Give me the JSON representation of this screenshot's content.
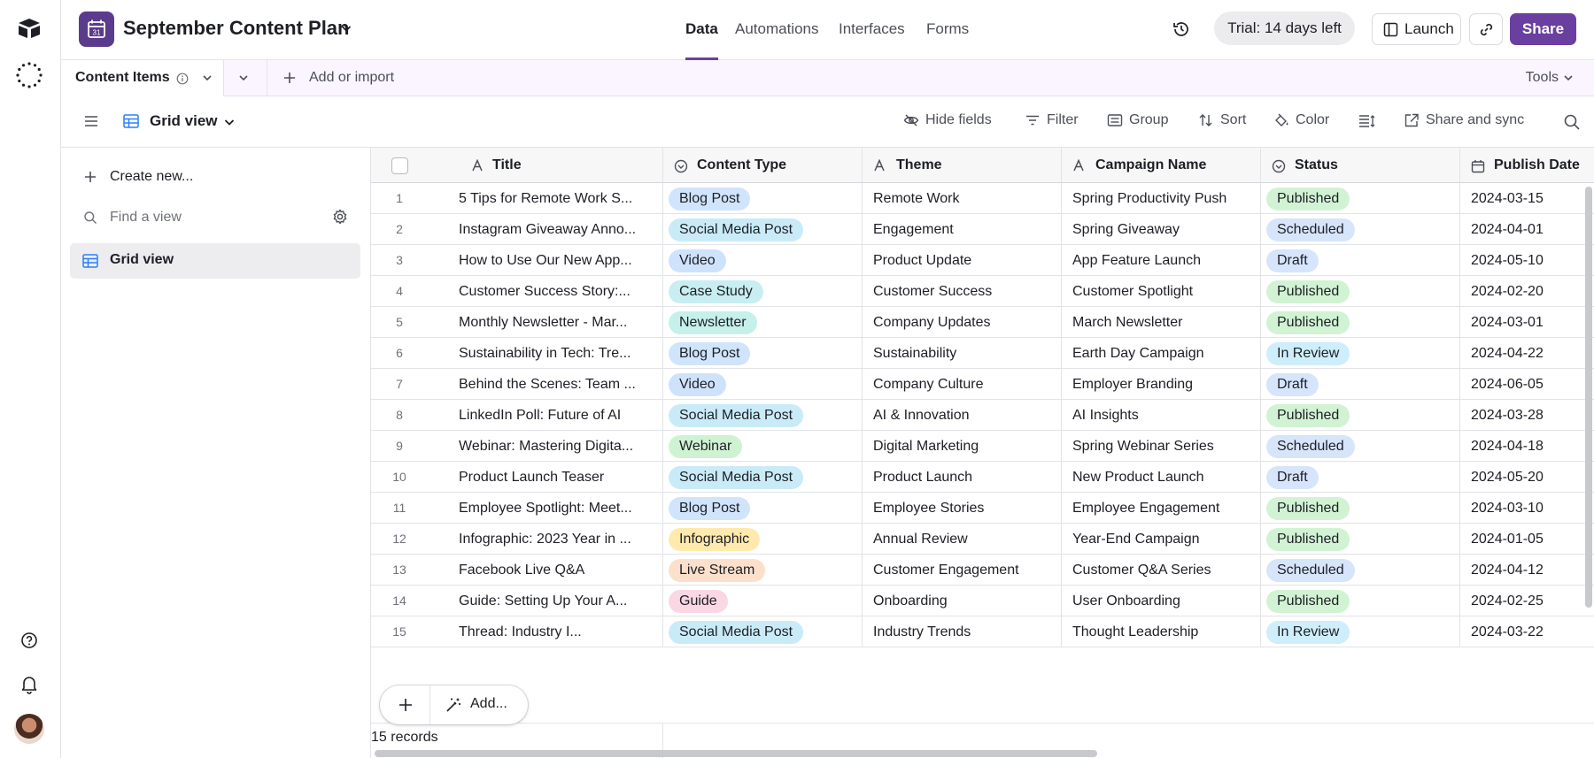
{
  "base": {
    "title": "September Content Plan",
    "icon": "calendar-icon",
    "calendar_day": "31",
    "brand_color": "#5b3b8c"
  },
  "nav": {
    "tabs": [
      {
        "label": "Data",
        "active": true
      },
      {
        "label": "Automations"
      },
      {
        "label": "Interfaces"
      },
      {
        "label": "Forms"
      }
    ]
  },
  "header": {
    "trial": "Trial: 14 days left",
    "launch": "Launch",
    "share": "Share",
    "accent": "#6a3fa0"
  },
  "tabs": {
    "table": "Content Items",
    "add_import": "Add or import",
    "tools": "Tools"
  },
  "view": {
    "name": "Grid view"
  },
  "toolbar": {
    "hide_fields": "Hide fields",
    "filter": "Filter",
    "group": "Group",
    "sort": "Sort",
    "color": "Color",
    "share_sync": "Share and sync"
  },
  "sidebar": {
    "create_new": "Create new...",
    "find_placeholder": "Find a view",
    "views": [
      {
        "label": "Grid view"
      }
    ]
  },
  "columns": {
    "title": "Title",
    "content_type": "Content Type",
    "theme": "Theme",
    "campaign": "Campaign Name",
    "status": "Status",
    "publish_date": "Publish Date"
  },
  "pill_colors": {
    "Blog Post": "#d0e4fb",
    "Social Media Post": "#c9ebf8",
    "Video": "#cfe2fc",
    "Case Study": "#c8eef2",
    "Newsletter": "#c6f0ea",
    "Webinar": "#cff2d3",
    "Infographic": "#ffe9ad",
    "Live Stream": "#fde0cc",
    "Guide": "#fbd6e3",
    "Published": "#d1f3d3",
    "Scheduled": "#d7e5fb",
    "Draft": "#d6e5fb",
    "In Review": "#cdeefa"
  },
  "rows": [
    {
      "n": "1",
      "title": "5 Tips for Remote Work S...",
      "type": "Blog Post",
      "theme": "Remote Work",
      "campaign": "Spring Productivity Push",
      "status": "Published",
      "date": "2024-03-15"
    },
    {
      "n": "2",
      "title": "Instagram Giveaway Anno...",
      "type": "Social Media Post",
      "theme": "Engagement",
      "campaign": "Spring Giveaway",
      "status": "Scheduled",
      "date": "2024-04-01"
    },
    {
      "n": "3",
      "title": "How to Use Our New App...",
      "type": "Video",
      "theme": "Product Update",
      "campaign": "App Feature Launch",
      "status": "Draft",
      "date": "2024-05-10"
    },
    {
      "n": "4",
      "title": "Customer Success Story:...",
      "type": "Case Study",
      "theme": "Customer Success",
      "campaign": "Customer Spotlight",
      "status": "Published",
      "date": "2024-02-20"
    },
    {
      "n": "5",
      "title": "Monthly Newsletter - Mar...",
      "type": "Newsletter",
      "theme": "Company Updates",
      "campaign": "March Newsletter",
      "status": "Published",
      "date": "2024-03-01"
    },
    {
      "n": "6",
      "title": "Sustainability in Tech: Tre...",
      "type": "Blog Post",
      "theme": "Sustainability",
      "campaign": "Earth Day Campaign",
      "status": "In Review",
      "date": "2024-04-22"
    },
    {
      "n": "7",
      "title": "Behind the Scenes: Team ...",
      "type": "Video",
      "theme": "Company Culture",
      "campaign": "Employer Branding",
      "status": "Draft",
      "date": "2024-06-05"
    },
    {
      "n": "8",
      "title": "LinkedIn Poll: Future of AI",
      "type": "Social Media Post",
      "theme": "AI & Innovation",
      "campaign": "AI Insights",
      "status": "Published",
      "date": "2024-03-28"
    },
    {
      "n": "9",
      "title": "Webinar: Mastering Digita...",
      "type": "Webinar",
      "theme": "Digital Marketing",
      "campaign": "Spring Webinar Series",
      "status": "Scheduled",
      "date": "2024-04-18"
    },
    {
      "n": "10",
      "title": "Product Launch Teaser",
      "type": "Social Media Post",
      "theme": "Product Launch",
      "campaign": "New Product Launch",
      "status": "Draft",
      "date": "2024-05-20"
    },
    {
      "n": "11",
      "title": "Employee Spotlight: Meet...",
      "type": "Blog Post",
      "theme": "Employee Stories",
      "campaign": "Employee Engagement",
      "status": "Published",
      "date": "2024-03-10"
    },
    {
      "n": "12",
      "title": "Infographic: 2023 Year in ...",
      "type": "Infographic",
      "theme": "Annual Review",
      "campaign": "Year-End Campaign",
      "status": "Published",
      "date": "2024-01-05"
    },
    {
      "n": "13",
      "title": "Facebook Live Q&A",
      "type": "Live Stream",
      "theme": "Customer Engagement",
      "campaign": "Customer Q&A Series",
      "status": "Scheduled",
      "date": "2024-04-12"
    },
    {
      "n": "14",
      "title": "Guide: Setting Up Your A...",
      "type": "Guide",
      "theme": "Onboarding",
      "campaign": "User Onboarding",
      "status": "Published",
      "date": "2024-02-25"
    },
    {
      "n": "15",
      "title": "Thread: Industry I...",
      "type": "Social Media Post",
      "theme": "Industry Trends",
      "campaign": "Thought Leadership",
      "status": "In Review",
      "date": "2024-03-22"
    }
  ],
  "footer": {
    "records": "15 records",
    "add_label": "Add..."
  }
}
